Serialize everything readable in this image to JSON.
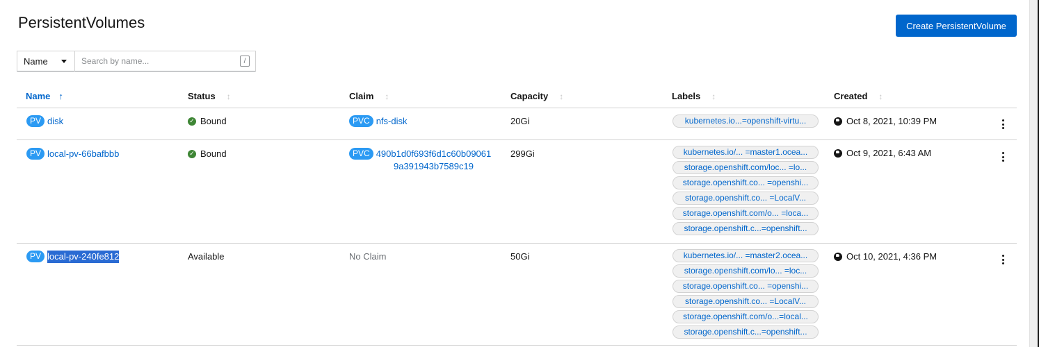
{
  "page": {
    "title": "PersistentVolumes",
    "create_button": "Create PersistentVolume"
  },
  "filter": {
    "type": "Name",
    "placeholder": "Search by name...",
    "shortcut": "/"
  },
  "columns": [
    "Name",
    "Status",
    "Claim",
    "Capacity",
    "Labels",
    "Created"
  ],
  "rows": [
    {
      "badge": "PV",
      "name": "disk",
      "status": "Bound",
      "claim_badge": "PVC",
      "claim": "nfs-disk",
      "claim_line2": "",
      "capacity": "20Gi",
      "labels": [
        "kubernetes.io...=openshift-virtu..."
      ],
      "created": "Oct 8, 2021, 10:39 PM"
    },
    {
      "badge": "PV",
      "name": "local-pv-66bafbbb",
      "status": "Bound",
      "claim_badge": "PVC",
      "claim": "490b1d0f693f6d1c60b09061",
      "claim_line2": "9a391943b7589c19",
      "capacity": "299Gi",
      "labels": [
        "kubernetes.io/...  =master1.ocea...",
        "storage.openshift.com/loc... =lo...",
        "storage.openshift.co...  =openshi...",
        "storage.openshift.co...  =LocalV...",
        "storage.openshift.com/o... =loca...",
        "storage.openshift.c...=openshift..."
      ],
      "created": "Oct 9, 2021, 6:43 AM"
    },
    {
      "badge": "PV",
      "name": "local-pv-240fe812",
      "status": "Available",
      "claim": "No Claim",
      "capacity": "50Gi",
      "labels": [
        "kubernetes.io/...  =master2.ocea...",
        "storage.openshift.com/lo... =loc...",
        "storage.openshift.co...  =openshi...",
        "storage.openshift.co...  =LocalV...",
        "storage.openshift.com/o...=local...",
        "storage.openshift.c...=openshift..."
      ],
      "created": "Oct 10, 2021, 4:36 PM"
    }
  ],
  "colors": {
    "primary": "#0066cc",
    "badge": "#2b9af3",
    "success": "#3e8635",
    "selection": "#2a6bd3"
  }
}
